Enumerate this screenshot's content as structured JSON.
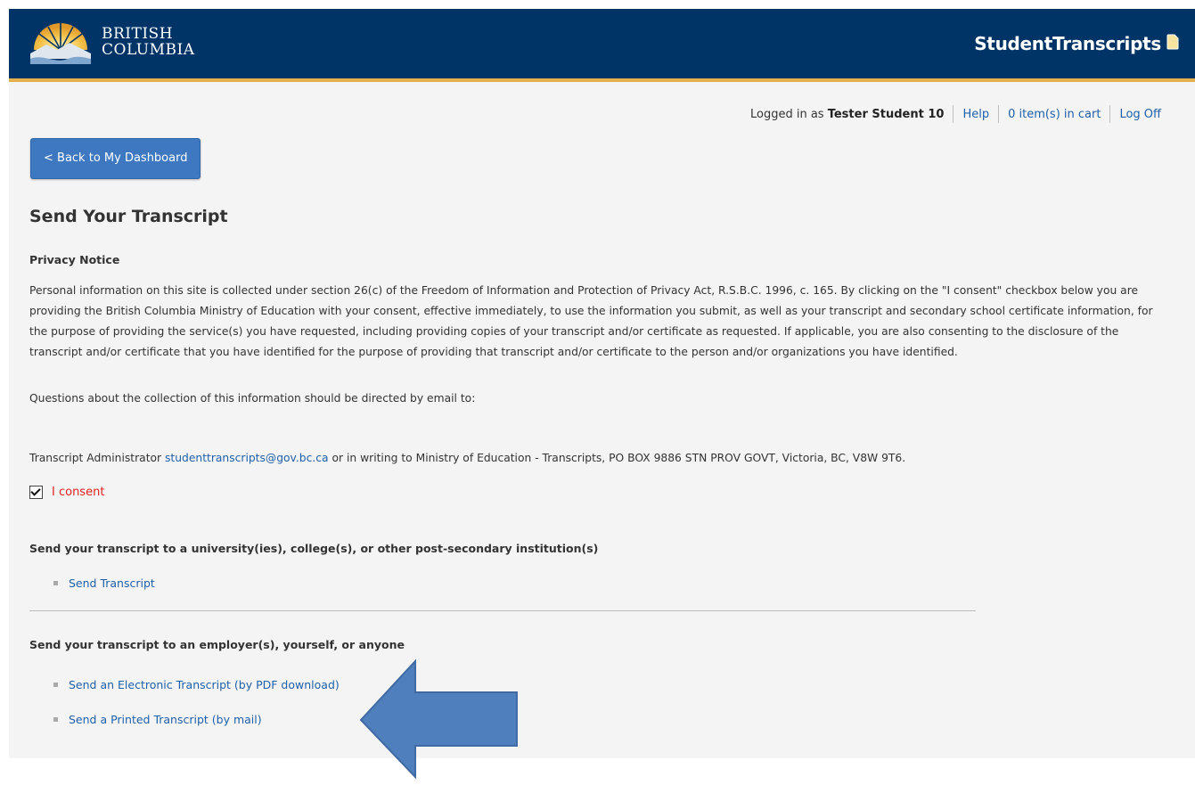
{
  "header": {
    "logo_line1": "BRITISH",
    "logo_line2": "COLUMBIA",
    "app_title": "StudentTranscripts",
    "app_icon": "document-icon",
    "bg_color": "#003366",
    "accent_color": "#e3b04b"
  },
  "userbar": {
    "logged_in_prefix": "Logged in as",
    "user_name": "Tester Student 10",
    "help_label": "Help",
    "cart_label": "0 item(s) in cart",
    "logoff_label": "Log Off"
  },
  "back_button": {
    "label": "< Back to My Dashboard",
    "color": "#3d78c1"
  },
  "page_title": "Send Your Transcript",
  "privacy": {
    "heading": "Privacy Notice",
    "body": "Personal information on this site is collected under section 26(c) of the Freedom of Information and Protection of Privacy Act, R.S.B.C. 1996, c. 165. By clicking on the \"I consent\" checkbox below you are providing the British Columbia Ministry of Education with your consent, effective immediately, to use the information you submit, as well as your transcript and secondary school certificate information, for the purpose of providing the service(s) you have requested, including providing copies of your transcript and/or certificate as requested. If applicable, you are also consenting to the disclosure of the transcript and/or certificate that you have identified for the purpose of providing that transcript and/or certificate to the person and/or organizations you have identified.",
    "questions": "Questions about the collection of this information should be directed by email to:",
    "admin_prefix": "Transcript Administrator",
    "admin_email": "studenttranscripts@gov.bc.ca",
    "admin_suffix": "or in writing to Ministry of Education - Transcripts, PO BOX 9886 STN PROV GOVT, Victoria, BC, V8W 9T6."
  },
  "consent": {
    "label": "I consent",
    "checked": true,
    "label_color": "#e02020"
  },
  "post_secondary": {
    "heading": "Send your transcript to a university(ies), college(s), or other post-secondary institution(s)",
    "links": [
      "Send Transcript"
    ]
  },
  "others": {
    "heading": "Send your transcript to an employer(s), yourself, or anyone",
    "links": [
      "Send an Electronic Transcript (by PDF download)",
      "Send a Printed Transcript (by mail)"
    ]
  },
  "annotation_arrow": {
    "color": "#4f7fbd",
    "icon": "arrow-left-icon"
  }
}
